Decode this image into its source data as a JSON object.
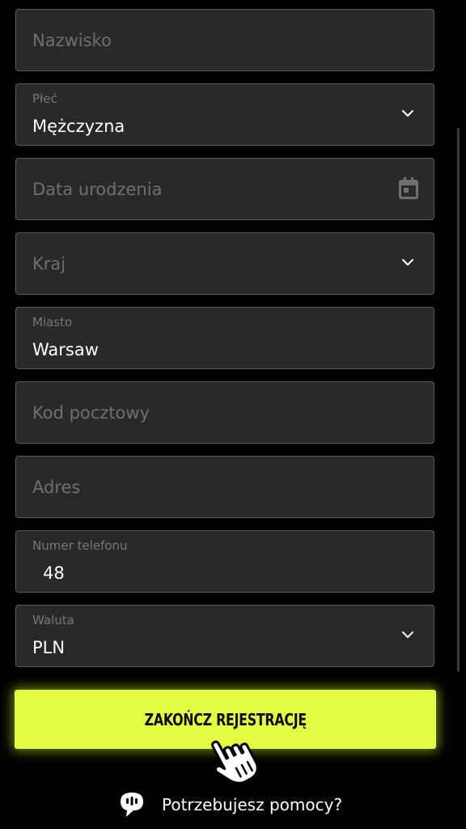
{
  "form": {
    "surname": {
      "placeholder": "Nazwisko"
    },
    "gender": {
      "label": "Płeć",
      "value": "Mężczyzna"
    },
    "birthdate": {
      "placeholder": "Data urodzenia",
      "icon": "calendar-icon"
    },
    "country": {
      "placeholder": "Kraj"
    },
    "city": {
      "label": "Miasto",
      "value": "Warsaw"
    },
    "postal_code": {
      "placeholder": "Kod pocztowy"
    },
    "address": {
      "placeholder": "Adres"
    },
    "phone": {
      "label": "Numer telefonu",
      "value": "48"
    },
    "currency": {
      "label": "Waluta",
      "value": "PLN"
    }
  },
  "submit": {
    "label": "ZAKOŃCZ REJESTRACJĘ"
  },
  "help": {
    "label": "Potrzebujesz pomocy?",
    "icon": "chat-bubble-icon"
  },
  "colors": {
    "background": "#000000",
    "field_background": "#29292b",
    "field_border": "#5a5a5c",
    "accent": "#e4fb44",
    "placeholder": "#6f6f71"
  }
}
